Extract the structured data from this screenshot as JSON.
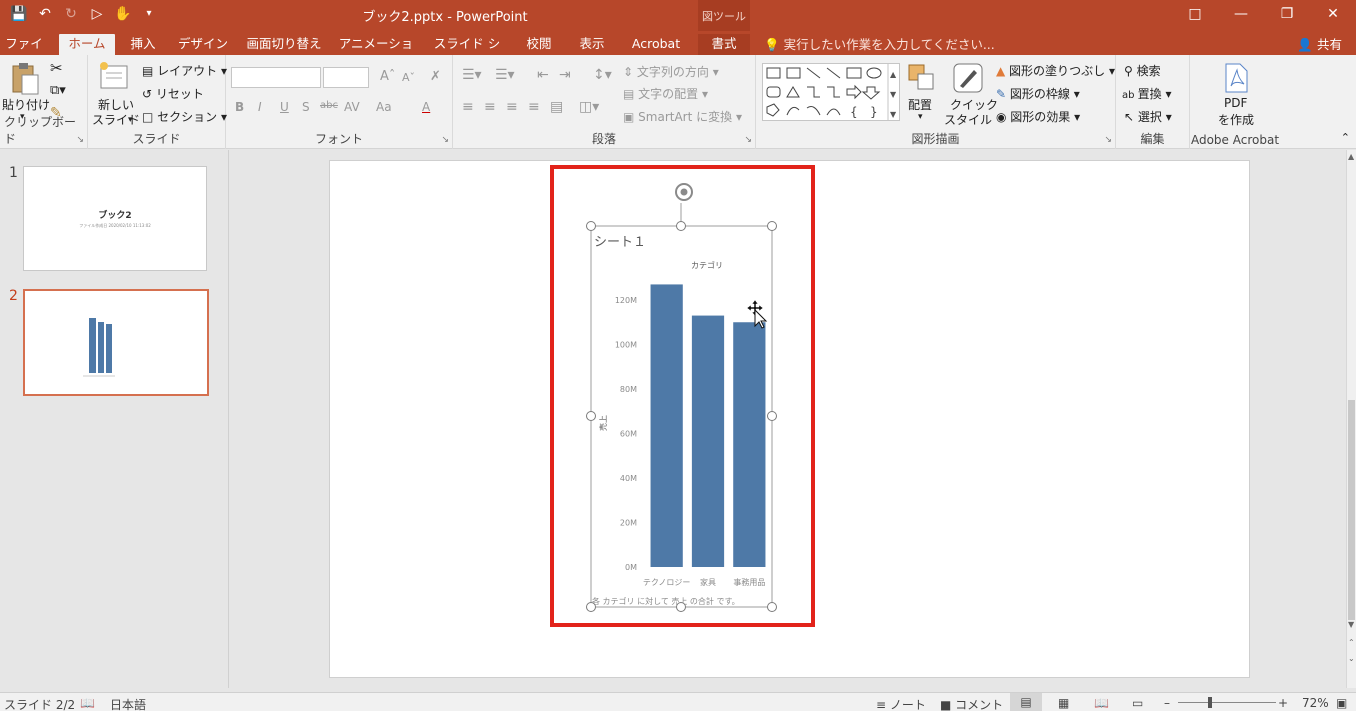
{
  "window": {
    "title": "ブック2.pptx - PowerPoint",
    "context_group": "図ツール",
    "controls": [
      "restore-ribbon",
      "minimize",
      "maximize",
      "close"
    ]
  },
  "qat": {
    "icons": [
      "save-icon",
      "undo-icon",
      "redo-icon",
      "present-icon",
      "touch-mode-icon",
      "customize-icon"
    ]
  },
  "tabs": [
    "ファイル",
    "ホーム",
    "挿入",
    "デザイン",
    "画面切り替え",
    "アニメーション",
    "スライド ショー",
    "校閲",
    "表示",
    "Acrobat",
    "書式"
  ],
  "active_tab": "ホーム",
  "tellme_placeholder": "実行したい作業を入力してください...",
  "share_label": "共有",
  "ribbon": {
    "clipboard": {
      "label": "クリップボード",
      "paste": "貼り付け"
    },
    "slides": {
      "label": "スライド",
      "new_slide_line1": "新しい",
      "new_slide_line2": "スライド",
      "layout": "レイアウト",
      "reset": "リセット",
      "section": "セクション"
    },
    "font": {
      "label": "フォント",
      "bold": "B",
      "italic": "I",
      "underline": "U",
      "shadow": "S",
      "strike": "abc",
      "spacing": "AV",
      "case": "Aa",
      "color": "A"
    },
    "paragraph": {
      "label": "段落",
      "text_direction": "文字列の方向",
      "align_text": "文字の配置",
      "smartart": "SmartArt に変換"
    },
    "drawing": {
      "label": "図形描画",
      "arrange": "配置",
      "quick_styles_line1": "クイック",
      "quick_styles_line2": "スタイル",
      "fill": "図形の塗りつぶし",
      "outline": "図形の枠線",
      "effects": "図形の効果"
    },
    "editing": {
      "label": "編集",
      "find": "検索",
      "replace": "置換",
      "select": "選択"
    },
    "acrobat": {
      "label": "Adobe Acrobat",
      "pdf_line1": "PDF",
      "pdf_line2": "を作成"
    }
  },
  "thumbnails": [
    {
      "number": "1",
      "title": "ブック2",
      "subtitle": "ファイル作成日 2020/02/10 11:13:02"
    },
    {
      "number": "2"
    }
  ],
  "selected_slide": 2,
  "chart_object": {
    "sheet_title": "シート１",
    "description": "各 カテゴリ に対して 売上 の合計 です。"
  },
  "chart_data": {
    "type": "bar",
    "title": "カテゴリ",
    "xlabel": "",
    "ylabel": "売上",
    "categories": [
      "テクノロジー",
      "家具",
      "事務用品"
    ],
    "values": [
      127,
      113,
      110
    ],
    "ylim": [
      0,
      120
    ],
    "y_ticks": [
      "0M",
      "20M",
      "40M",
      "60M",
      "80M",
      "100M",
      "120M"
    ],
    "bar_color": "#4e79a7",
    "grid": false
  },
  "status": {
    "slide": "スライド 2/2",
    "language": "日本語",
    "notes": "ノート",
    "comments": "コメント",
    "zoom": "72%"
  },
  "colors": {
    "accent": "#b7472a",
    "selection": "#e2231a"
  }
}
